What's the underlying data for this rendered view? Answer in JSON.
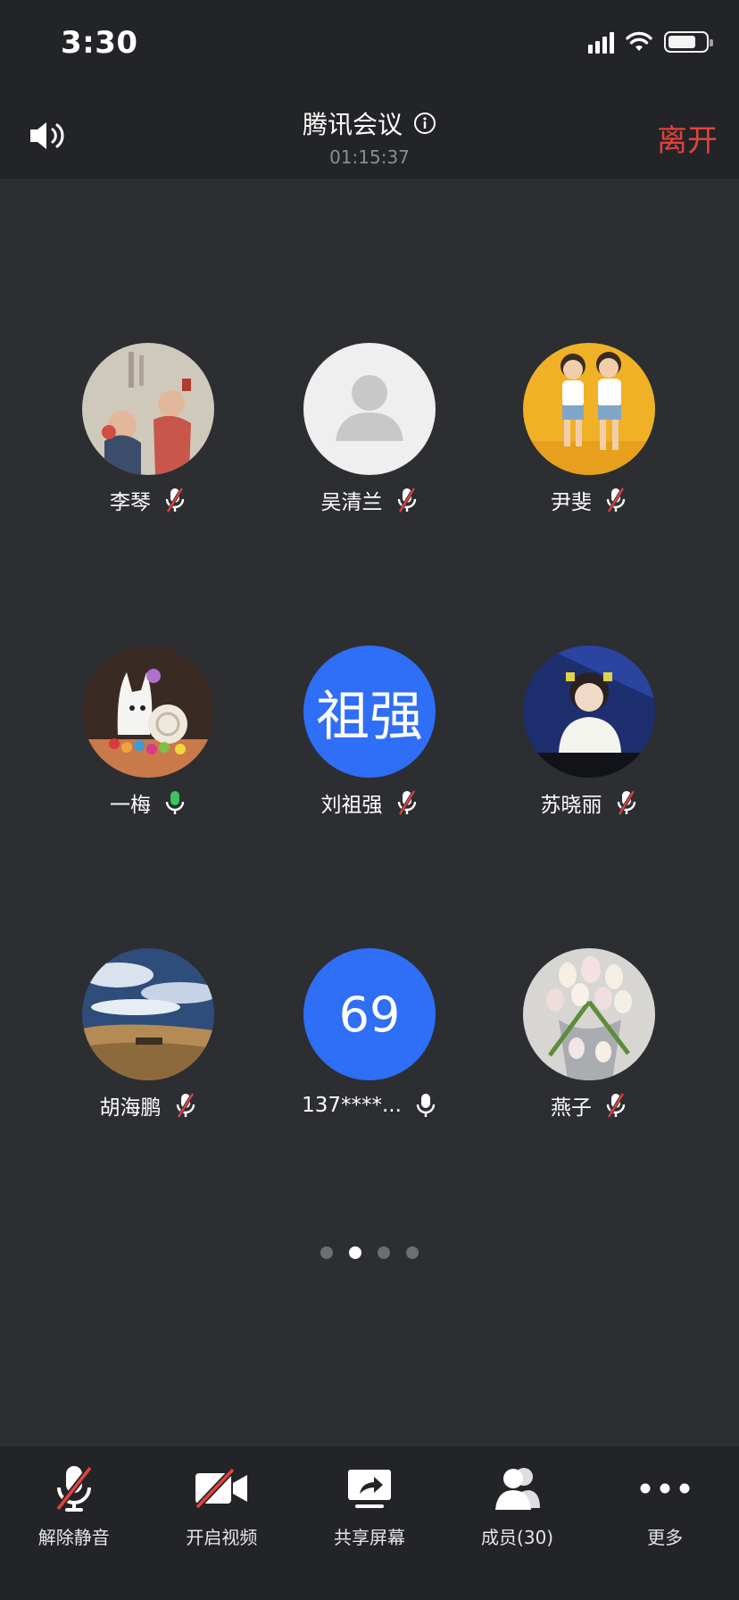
{
  "status_bar": {
    "time": "3:30"
  },
  "meeting": {
    "title": "腾讯会议",
    "duration": "01:15:37",
    "leave_label": "离开"
  },
  "participants": [
    {
      "name": "李琴",
      "mic": "muted",
      "avatar": "painting-photo"
    },
    {
      "name": "吴清兰",
      "mic": "muted",
      "avatar": "default-person"
    },
    {
      "name": "尹斐",
      "mic": "muted",
      "avatar": "kids-photo"
    },
    {
      "name": "一梅",
      "mic": "active",
      "avatar": "toy-photo"
    },
    {
      "name": "刘祖强",
      "mic": "muted",
      "avatar_text": "祖强"
    },
    {
      "name": "苏晓丽",
      "mic": "muted",
      "avatar": "girl-photo"
    },
    {
      "name": "胡海鹏",
      "mic": "muted",
      "avatar": "desert-photo"
    },
    {
      "name": "137****...",
      "mic": "on",
      "avatar_text": "69"
    },
    {
      "name": "燕子",
      "mic": "muted",
      "avatar": "tulips-photo"
    }
  ],
  "pagination": {
    "pages": 4,
    "current": 2
  },
  "toolbar": {
    "unmute_label": "解除静音",
    "video_label": "开启视频",
    "share_label": "共享屏幕",
    "members_label": "成员(30)",
    "more_label": "更多"
  },
  "colors": {
    "background": "#2c2e32",
    "bar": "#232427",
    "leave": "#e5413b",
    "avatar_blue": "#2f6ef6",
    "mic_active": "#3cc25e",
    "mute_slash": "#e5413b"
  }
}
